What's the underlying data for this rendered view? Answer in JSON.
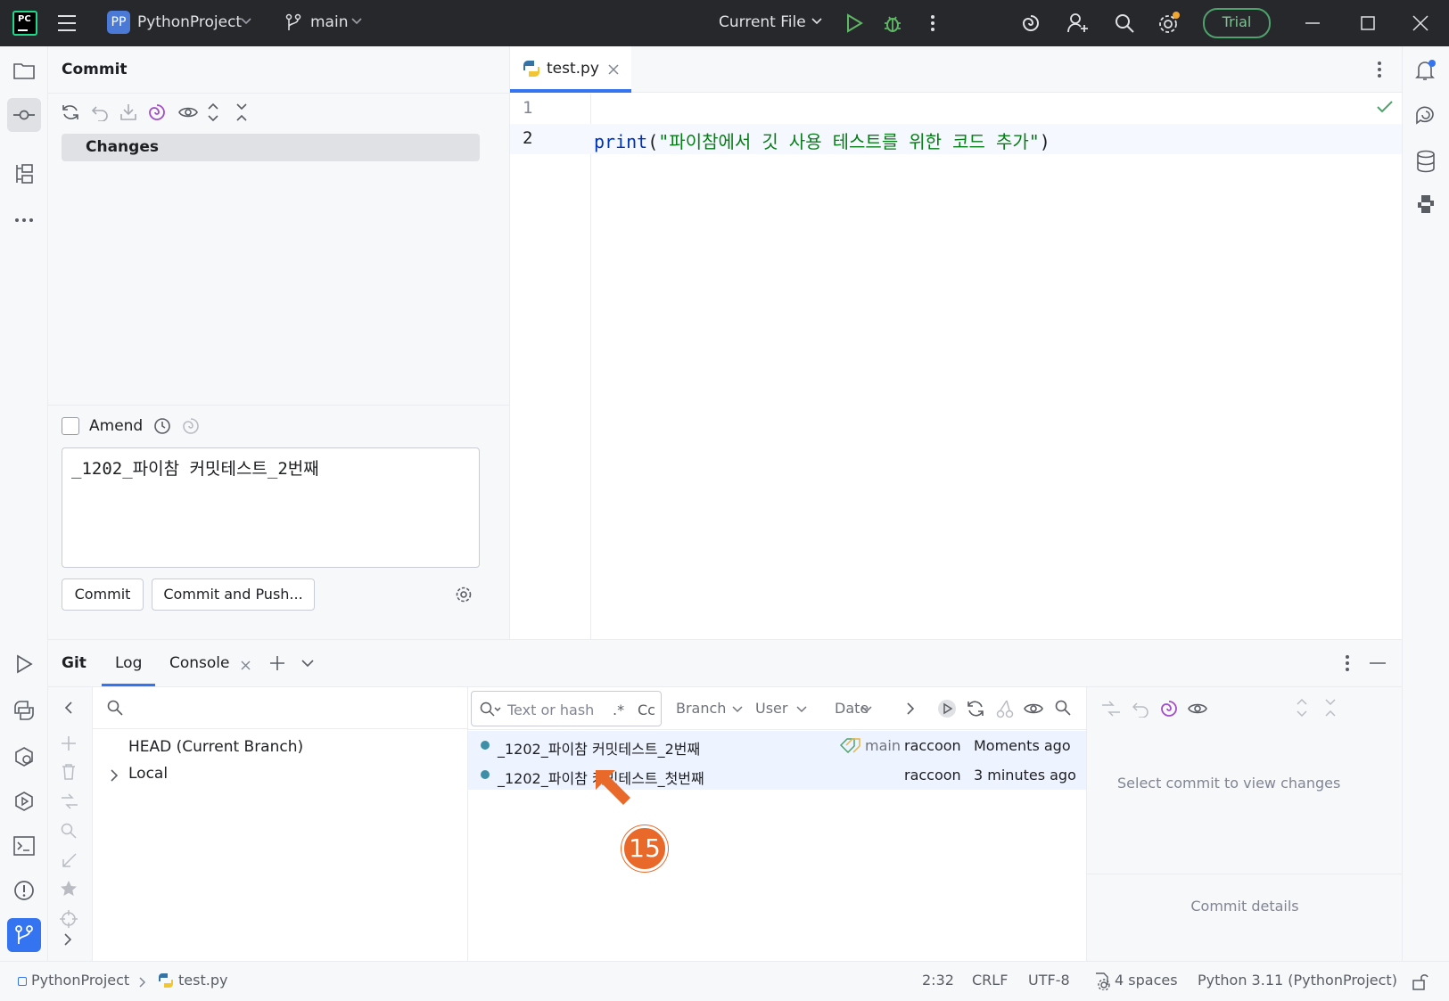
{
  "titlebar": {
    "project_badge": "PP",
    "project_name": "PythonProject",
    "branch": "main",
    "run_config": "Current File",
    "trial_label": "Trial"
  },
  "commit_panel": {
    "title": "Commit",
    "changes_label": "Changes",
    "amend_label": "Amend",
    "message": "_1202_파이참 커밋테스트_2번째",
    "commit_button": "Commit",
    "commit_push_button": "Commit and Push..."
  },
  "editor": {
    "tab_name": "test.py",
    "lines": [
      {
        "num": "1",
        "fn": "",
        "open": "",
        "str": "",
        "close": ""
      },
      {
        "num": "2",
        "fn": "print",
        "open": "(",
        "str": "\"파이참에서 깃 사용 테스트를 위한 코드 추가\"",
        "close": ")"
      }
    ]
  },
  "git_panel": {
    "tabs": [
      "Git",
      "Log",
      "Console"
    ],
    "branches": {
      "head": "HEAD (Current Branch)",
      "local": "Local"
    },
    "search_placeholder": "Text or hash",
    "regex_label": ".*",
    "case_label": "Cc",
    "filters": [
      "Branch",
      "User",
      "Date"
    ],
    "commits": [
      {
        "message": "_1202_파이참 커밋테스트_2번째",
        "tag": "main",
        "author": "raccoon",
        "time": "Moments ago"
      },
      {
        "message": "_1202_파이참 커밋테스트_첫번째",
        "tag": "",
        "author": "raccoon",
        "time": "3 minutes ago"
      }
    ],
    "details_placeholder": "Select commit to view changes",
    "commit_details_label": "Commit details"
  },
  "annotation_badge": "15",
  "statusbar": {
    "project": "PythonProject",
    "file": "test.py",
    "position": "2:32",
    "line_sep": "CRLF",
    "encoding": "UTF-8",
    "indent": "4 spaces",
    "interpreter": "Python 3.11 (PythonProject)"
  },
  "colors": {
    "accent": "#3574f0",
    "titlebar_bg": "#27282c",
    "badge": "#e8692a",
    "graph_node": "#3d8fa8"
  }
}
